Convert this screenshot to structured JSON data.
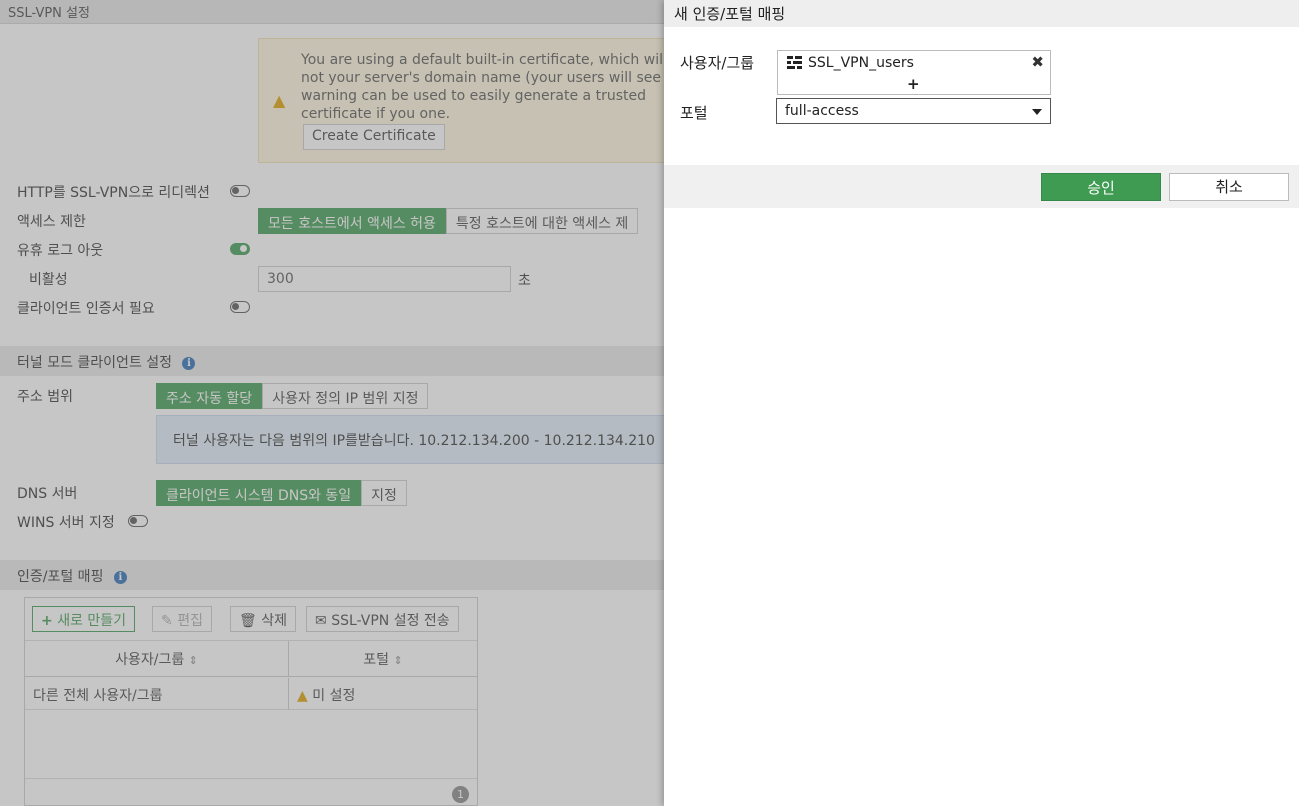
{
  "background": {
    "title": "SSL-VPN 설정",
    "cert_warning": {
      "text": "You are using a default built-in certificate, which will not your server's domain name (your users will see a warning can be used to easily generate a trusted certificate if you one.",
      "button": "Create Certificate"
    },
    "http_redirect": {
      "label": "HTTP를 SSL-VPN으로 리디렉션",
      "enabled": false
    },
    "access_limit": {
      "label": "액세스 제한",
      "options": [
        "모든 호스트에서 액세스 허용",
        "특정 호스트에 대한 액세스 제"
      ],
      "selected": "모든 호스트에서 액세스 허용"
    },
    "idle_logout": {
      "label": "유휴 로그 아웃",
      "enabled": true
    },
    "inactivity": {
      "label": "비활성",
      "value": "300",
      "unit": "초"
    },
    "client_cert": {
      "label": "클라이언트 인증서 필요",
      "enabled": false
    },
    "tunnel_section": {
      "title": "터널 모드 클라이언트 설정"
    },
    "address_range": {
      "label": "주소 범위",
      "options": [
        "주소 자동 할당",
        "사용자 정의 IP 범위 지정"
      ],
      "selected": "주소 자동 할당"
    },
    "ip_note": "터널 사용자는 다음 범위의 IP를받습니다. 10.212.134.200 - 10.212.134.210",
    "dns_server": {
      "label": "DNS 서버",
      "options": [
        "클라이언트 시스템 DNS와 동일",
        "지정"
      ],
      "selected": "클라이언트 시스템 DNS와 동일"
    },
    "wins_server": {
      "label": "WINS 서버 지정",
      "enabled": false
    },
    "mapping_section": {
      "title": "인증/포털 매핑"
    },
    "toolbar": {
      "create": "새로 만들기",
      "edit": "편집",
      "delete": "삭제",
      "send": "SSL-VPN 설정 전송"
    },
    "table": {
      "columns": [
        "사용자/그룹",
        "포털"
      ],
      "rows": [
        {
          "user_group": "다른 전체 사용자/그룹",
          "portal": "미 설정"
        }
      ],
      "count": "1"
    }
  },
  "panel": {
    "title": "새 인증/포털 매핑",
    "user_group_label": "사용자/그룹",
    "user_group_value": "SSL_VPN_users",
    "add_symbol": "+",
    "remove_symbol": "✖",
    "portal_label": "포털",
    "portal_value": "full-access",
    "ok_label": "승인",
    "cancel_label": "취소"
  },
  "colors": {
    "accent": "#3f9b52",
    "warning_bg": "#fff7dc",
    "info_bg": "#e1edf8",
    "info_icon": "#2a6db5"
  }
}
